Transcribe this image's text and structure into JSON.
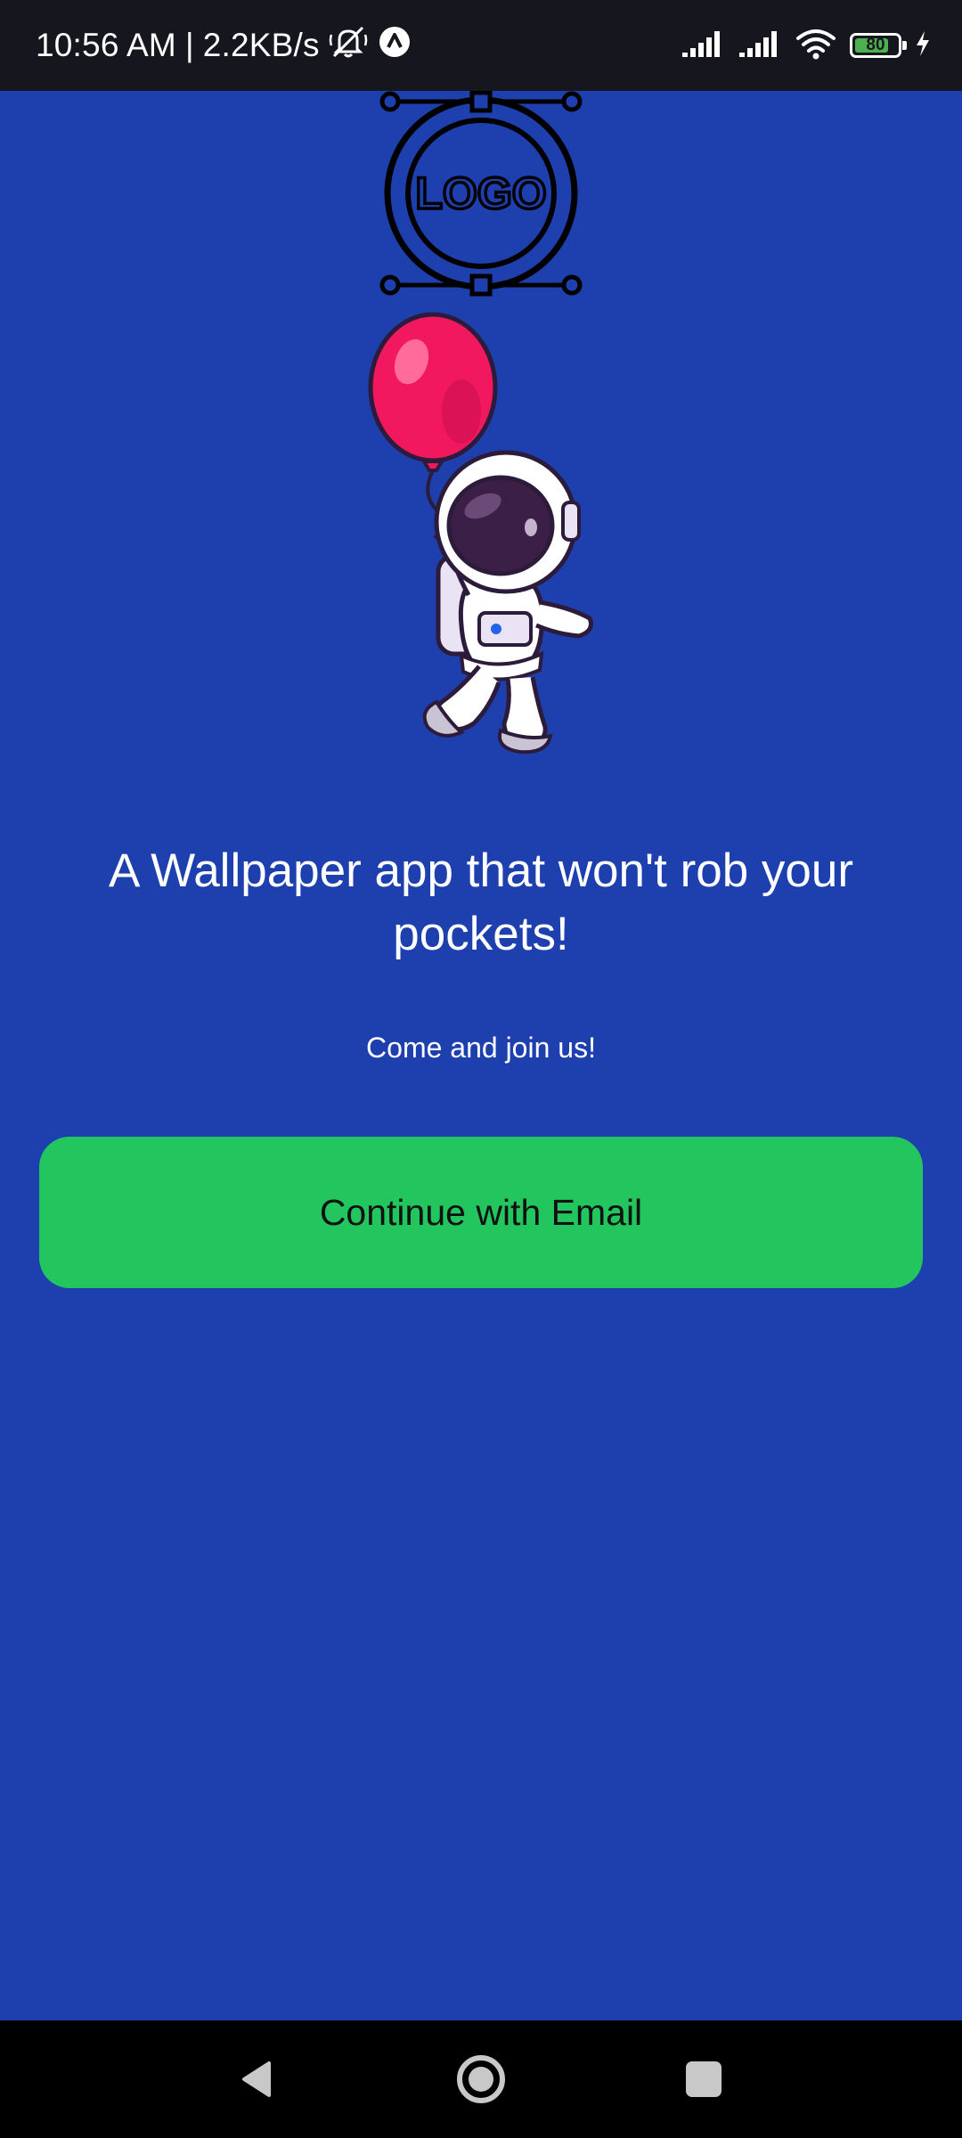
{
  "status_bar": {
    "time": "10:56 AM",
    "separator": "|",
    "net_speed": "2.2KB/s",
    "battery_level": "80",
    "battery_percent": 80,
    "icons": [
      "mute-icon",
      "app-notification-icon",
      "signal-icon",
      "wifi-icon",
      "battery-icon",
      "charging-icon"
    ]
  },
  "main": {
    "logo_text": "LOGO",
    "headline": "A Wallpaper app that won't rob your pockets!",
    "subtitle": "Come and join us!",
    "cta_label": "Continue with Email"
  },
  "nav_bar": {
    "icons": [
      "back-icon",
      "home-icon",
      "recents-icon"
    ]
  },
  "colors": {
    "background": "#1e40af",
    "button": "#22c55e",
    "status_bar": "#16161e",
    "balloon": "#f1185f"
  }
}
